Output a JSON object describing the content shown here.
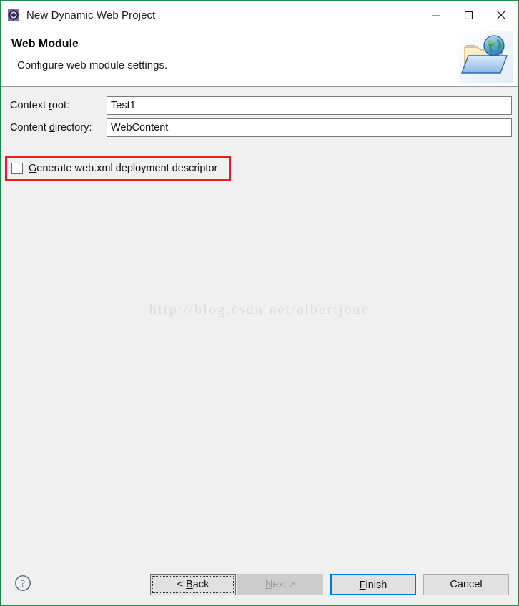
{
  "window": {
    "title": "New Dynamic Web Project",
    "icon": "eclipse-project-gear-icon",
    "border_color": "#1b8c4e",
    "controls": {
      "minimize": "minimize-icon",
      "maximize": "maximize-icon",
      "close": "close-icon"
    }
  },
  "header": {
    "title": "Web Module",
    "description": "Configure web module settings.",
    "banner_icon": "folder-with-globe-icon"
  },
  "form": {
    "context_root": {
      "label": "Context root:",
      "label_mnemonic_prefix": "Context ",
      "label_mnemonic": "r",
      "label_mnemonic_suffix": "oot:",
      "value": "Test1",
      "placeholder": ""
    },
    "content_directory": {
      "label": "Content directory:",
      "label_mnemonic_prefix": "Content ",
      "label_mnemonic": "d",
      "label_mnemonic_suffix": "irectory:",
      "value": "WebContent",
      "placeholder": ""
    },
    "generate_webxml": {
      "label": "Generate web.xml deployment descriptor",
      "label_mnemonic": "G",
      "label_rest": "enerate web.xml deployment descriptor",
      "checked": false
    }
  },
  "annotation": {
    "type": "red-highlight-rectangle",
    "color": "#ee1b1b",
    "target": "generate-webxml-checkbox"
  },
  "watermark": {
    "text": "http://blog.csdn.net/albertjone",
    "color": "#dcdcdc"
  },
  "footer": {
    "help_icon": "question-mark-help-icon",
    "buttons": {
      "back": {
        "label": "< Back",
        "mnemonic": "B",
        "before": "< ",
        "after": "ack",
        "enabled": true,
        "focused": true
      },
      "next": {
        "label": "Next >",
        "mnemonic": "N",
        "before": "",
        "after": "ext >",
        "enabled": false,
        "focused": false
      },
      "finish": {
        "label": "Finish",
        "mnemonic": "F",
        "before": "",
        "after": "inish",
        "enabled": true,
        "default": true,
        "accent_color": "#0078d7"
      },
      "cancel": {
        "label": "Cancel",
        "mnemonic": "",
        "before": "Cancel",
        "after": "",
        "enabled": true,
        "focused": false
      }
    }
  }
}
